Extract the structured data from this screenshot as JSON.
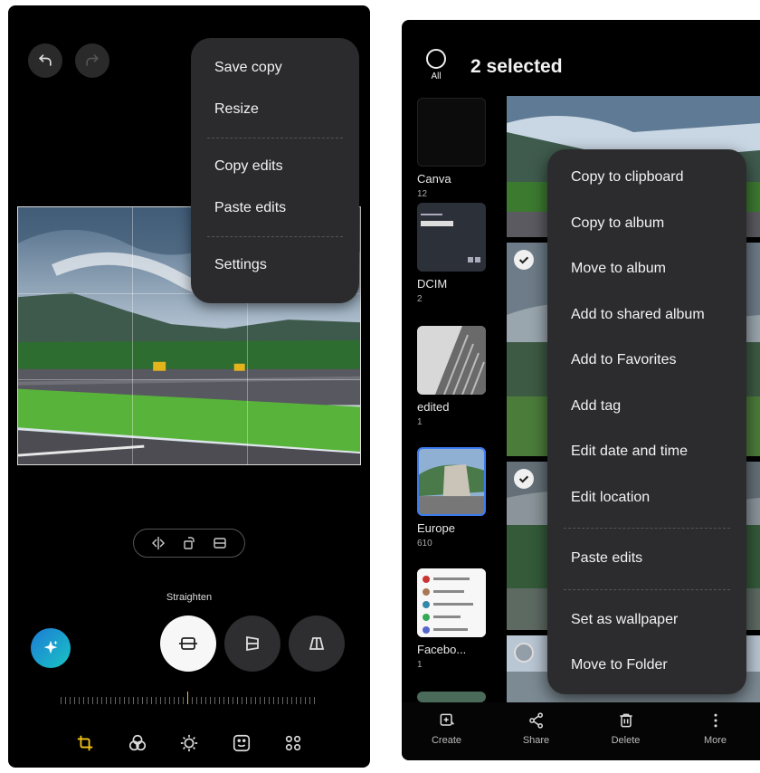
{
  "editor": {
    "menu": {
      "items": [
        "Save copy",
        "Resize",
        "Copy edits",
        "Paste edits",
        "Settings"
      ]
    },
    "straighten_label": "Straighten",
    "accent_color": "#f5c518",
    "icons": {
      "undo": "undo-icon",
      "redo": "redo-icon",
      "flip": "flip-horizontal-icon",
      "rotate": "rotate-icon",
      "aspect": "aspect-ratio-icon",
      "ai": "ai-sparkle-icon",
      "straighten": "straighten-icon",
      "vertical": "vertical-perspective-icon",
      "horizontal": "horizontal-perspective-icon",
      "tabs": [
        "crop-rotate-icon",
        "filters-icon",
        "brightness-icon",
        "sticker-icon",
        "more-tools-icon"
      ]
    }
  },
  "gallery": {
    "select_all_label": "All",
    "selection_title": "2 selected",
    "albums": [
      {
        "name": "Canva",
        "count": "12"
      },
      {
        "name": "DCIM",
        "count": "2"
      },
      {
        "name": "edited",
        "count": "1"
      },
      {
        "name": "Europe",
        "count": "610"
      },
      {
        "name": "Facebo...",
        "count": "1"
      }
    ],
    "menu": {
      "items": [
        "Copy to clipboard",
        "Copy to album",
        "Move to album",
        "Add to shared album",
        "Add to Favorites",
        "Add tag",
        "Edit date and time",
        "Edit location",
        "Paste edits",
        "Set as wallpaper",
        "Move to Folder"
      ]
    },
    "bottom_bar": [
      {
        "label": "Create",
        "icon": "create-icon"
      },
      {
        "label": "Share",
        "icon": "share-icon"
      },
      {
        "label": "Delete",
        "icon": "delete-icon"
      },
      {
        "label": "More",
        "icon": "more-icon"
      }
    ],
    "selection_color": "#3d7bf0"
  }
}
